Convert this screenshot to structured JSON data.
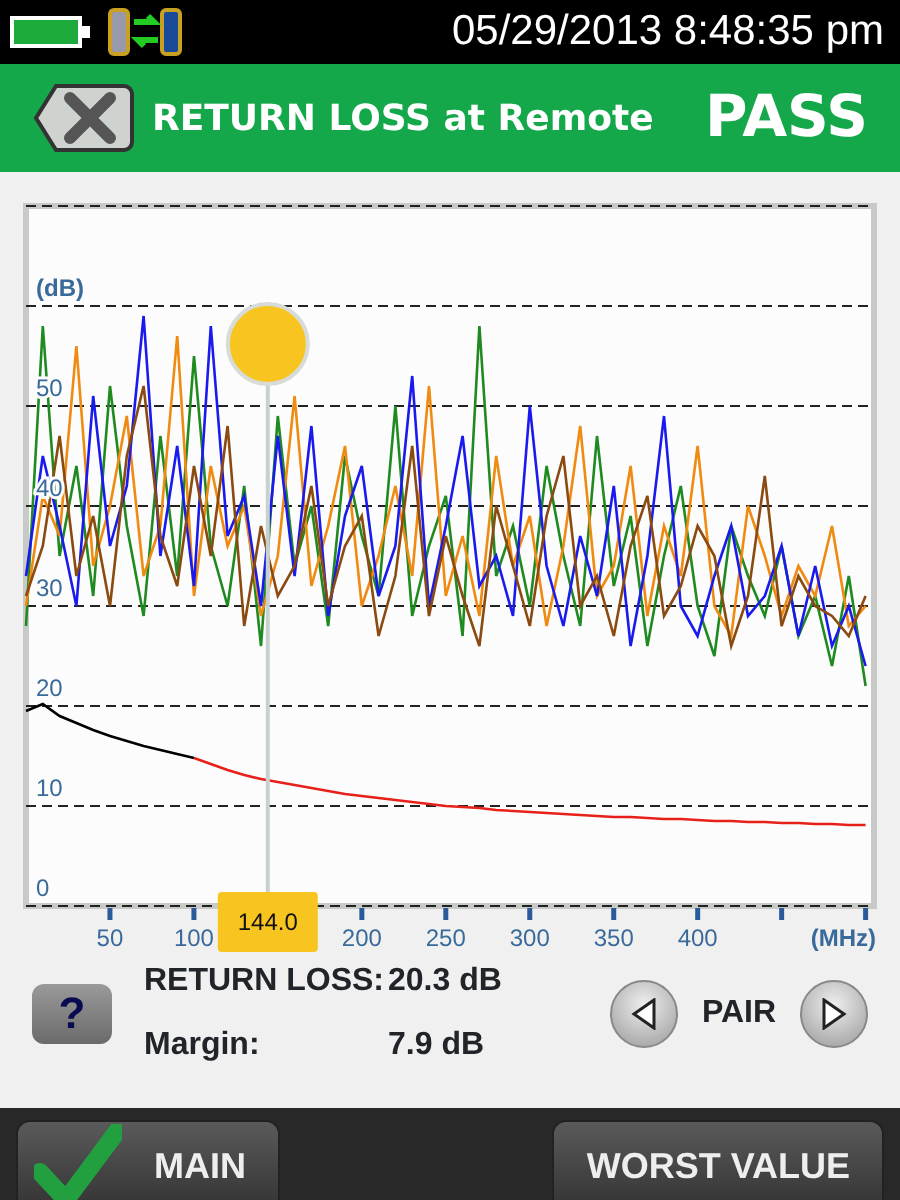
{
  "status_bar": {
    "datetime": "05/29/2013 8:48:35 pm"
  },
  "header": {
    "title": "RETURN LOSS at Remote",
    "result": "PASS"
  },
  "chart_data": {
    "type": "line",
    "ylabel": "(dB)",
    "xlabel": "(MHz)",
    "xlim": [
      0,
      505
    ],
    "ylim": [
      0,
      70
    ],
    "grid": true,
    "xticks": [
      50,
      100,
      200,
      250,
      300,
      350,
      400
    ],
    "yticks": [
      0,
      10,
      20,
      30,
      40,
      50
    ],
    "x": [
      0,
      10,
      20,
      30,
      40,
      50,
      60,
      70,
      80,
      90,
      100,
      110,
      120,
      130,
      140,
      150,
      160,
      170,
      180,
      190,
      200,
      210,
      220,
      230,
      240,
      250,
      260,
      270,
      280,
      290,
      300,
      310,
      320,
      330,
      340,
      350,
      360,
      370,
      380,
      390,
      400,
      410,
      420,
      430,
      440,
      450,
      460,
      470,
      480,
      490,
      500
    ],
    "series": [
      {
        "color": "#1f8a1f",
        "values": [
          28,
          58,
          35,
          44,
          31,
          52,
          38,
          29,
          47,
          33,
          55,
          36,
          30,
          42,
          26,
          49,
          34,
          40,
          28,
          45,
          37,
          31,
          50,
          29,
          36,
          41,
          27,
          58,
          33,
          38,
          30,
          44,
          35,
          28,
          47,
          32,
          39,
          26,
          35,
          42,
          30,
          25,
          38,
          33,
          29,
          36,
          27,
          31,
          24,
          33,
          22
        ]
      },
      {
        "color": "#f08a10",
        "values": [
          30,
          41,
          37,
          56,
          34,
          40,
          49,
          33,
          38,
          57,
          31,
          44,
          36,
          40,
          29,
          35,
          51,
          32,
          38,
          46,
          30,
          35,
          42,
          33,
          52,
          31,
          37,
          29,
          45,
          34,
          39,
          28,
          36,
          48,
          31,
          34,
          44,
          29,
          38,
          33,
          46,
          30,
          27,
          40,
          35,
          29,
          34,
          31,
          38,
          28,
          30
        ]
      },
      {
        "color": "#1a1aee",
        "values": [
          33,
          45,
          38,
          30,
          51,
          36,
          42,
          59,
          35,
          46,
          32,
          58,
          37,
          41,
          30,
          47,
          33,
          48,
          29,
          39,
          44,
          31,
          36,
          53,
          30,
          38,
          47,
          32,
          35,
          29,
          50,
          34,
          28,
          37,
          31,
          42,
          26,
          35,
          49,
          30,
          27,
          33,
          38,
          29,
          31,
          36,
          27,
          34,
          26,
          30,
          24
        ]
      },
      {
        "color": "#8a4a10",
        "values": [
          31,
          36,
          47,
          33,
          39,
          30,
          45,
          52,
          37,
          32,
          44,
          35,
          48,
          28,
          38,
          31,
          34,
          42,
          30,
          36,
          39,
          27,
          33,
          46,
          29,
          37,
          31,
          26,
          40,
          34,
          28,
          39,
          45,
          30,
          33,
          27,
          36,
          41,
          29,
          32,
          38,
          35,
          26,
          31,
          43,
          28,
          33,
          30,
          29,
          27,
          31
        ]
      },
      {
        "color": "#000000",
        "values": [
          19.5,
          20.2,
          19,
          18.3,
          17.6,
          17,
          16.5,
          16,
          15.6,
          15.2,
          14.8,
          null,
          null,
          null,
          null,
          null,
          null,
          null,
          null,
          null,
          null,
          null,
          null,
          null,
          null,
          null,
          null,
          null,
          null,
          null,
          null,
          null,
          null,
          null,
          null,
          null,
          null,
          null,
          null,
          null,
          null,
          null,
          null,
          null,
          null,
          null,
          null,
          null,
          null,
          null,
          null
        ]
      },
      {
        "color": "#e8201a",
        "values": [
          null,
          null,
          null,
          null,
          null,
          null,
          null,
          null,
          null,
          null,
          14.8,
          14.2,
          13.6,
          13.1,
          12.7,
          12.4,
          12.1,
          11.8,
          11.5,
          11.2,
          11,
          10.8,
          10.6,
          10.4,
          10.2,
          10,
          9.9,
          9.8,
          9.6,
          9.5,
          9.4,
          9.3,
          9.2,
          9.1,
          9,
          8.9,
          8.9,
          8.8,
          8.7,
          8.7,
          8.6,
          8.5,
          8.5,
          8.4,
          8.4,
          8.3,
          8.3,
          8.2,
          8.2,
          8.1,
          8.1
        ]
      }
    ],
    "annotations": [
      "144.0"
    ]
  },
  "help_button": {
    "label": "?"
  },
  "readings": [
    {
      "label": "RETURN LOSS:",
      "value": "20.3 dB"
    },
    {
      "label": "Margin:",
      "value": "7.9 dB"
    }
  ],
  "pair": {
    "label": "PAIR"
  },
  "buttons": [
    {
      "kind": "main",
      "label": "MAIN"
    },
    {
      "kind": "plain",
      "label": "WORST VALUE"
    }
  ]
}
